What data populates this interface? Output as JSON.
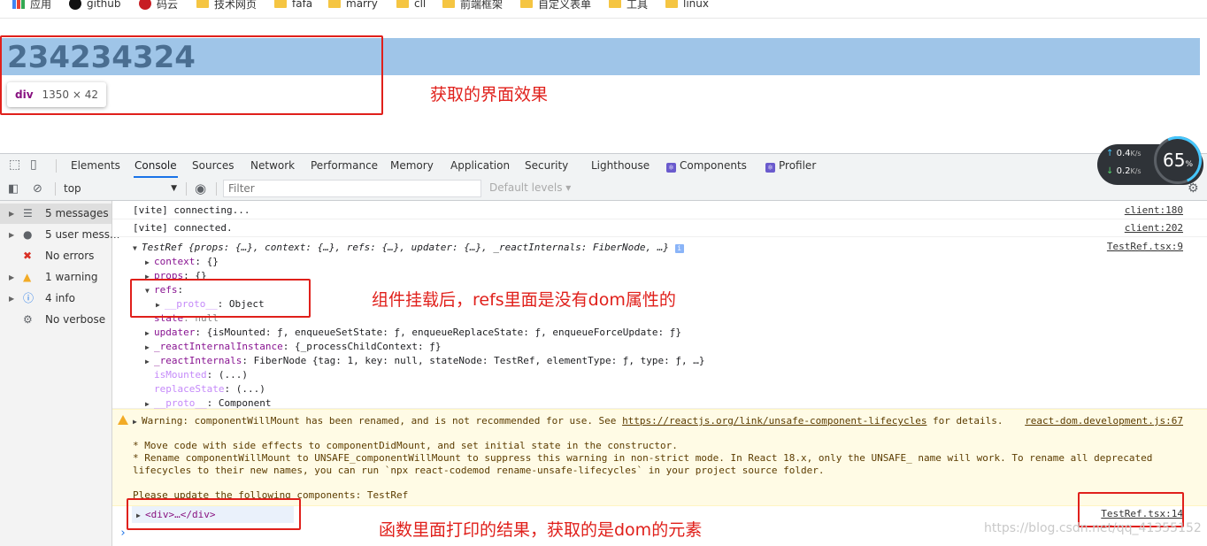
{
  "bookmarks": [
    {
      "label": "应用",
      "icon": "apps-grid-icon"
    },
    {
      "label": "github",
      "icon": "github-icon"
    },
    {
      "label": "码云",
      "icon": "gitee-icon"
    },
    {
      "label": "技术网页",
      "icon": "folder-icon"
    },
    {
      "label": "fafa",
      "icon": "folder-icon"
    },
    {
      "label": "marry",
      "icon": "folder-icon"
    },
    {
      "label": "cll",
      "icon": "folder-icon"
    },
    {
      "label": "前端框架",
      "icon": "folder-icon"
    },
    {
      "label": "自定义表单",
      "icon": "folder-icon"
    },
    {
      "label": "工具",
      "icon": "folder-icon"
    },
    {
      "label": "linux",
      "icon": "folder-icon"
    }
  ],
  "page": {
    "big_number": "234234324",
    "tooltip_tag": "div",
    "tooltip_dims": "1350 × 42"
  },
  "annotations": {
    "top_note": "获取的界面效果",
    "refs_note": "组件挂载后，refs里面是没有dom属性的",
    "bottom_note": "函数里面打印的结果，获取的是dom的元素"
  },
  "devtools": {
    "tabs": [
      "Elements",
      "Console",
      "Sources",
      "Network",
      "Performance",
      "Memory",
      "Application",
      "Security",
      "Lighthouse",
      "Components",
      "Profiler"
    ],
    "active_tab": "Console",
    "context": "top",
    "filter_placeholder": "Filter",
    "levels": "Default levels ▾",
    "sidebar": [
      {
        "label": "5 messages",
        "icon": "list-icon"
      },
      {
        "label": "5 user mess...",
        "icon": "user-icon"
      },
      {
        "label": "No errors",
        "icon": "error-icon"
      },
      {
        "label": "1 warning",
        "icon": "warning-icon"
      },
      {
        "label": "4 info",
        "icon": "info-icon"
      },
      {
        "label": "No verbose",
        "icon": "verbose-gear-icon"
      }
    ]
  },
  "console": {
    "vite1": {
      "text": "[vite] connecting...",
      "src": "client:180"
    },
    "vite2": {
      "text": "[vite] connected.",
      "src": "client:202"
    },
    "testref": {
      "head": "TestRef {props: {…}, context: {…}, refs: {…}, updater: {…}, _reactInternals: FiberNode, …}",
      "src": "TestRef.tsx:9",
      "context_key": "context",
      "context_val": ": {}",
      "props_key": "props",
      "props_val": ": {}",
      "refs_key": "refs",
      "proto_key": "__proto__",
      "proto_val": ": Object",
      "state_key": "state",
      "state_val": ": null",
      "updater_key": "updater",
      "updater_val": ": {isMounted: ƒ, enqueueSetState: ƒ, enqueueReplaceState: ƒ, enqueueForceUpdate: ƒ}",
      "ri_key": "_reactInternalInstance",
      "ri_val": ": {_processChildContext: ƒ}",
      "rin_key": "_reactInternals",
      "rin_val": ": FiberNode {tag: 1, key: null, stateNode: TestRef, elementType: ƒ, type: ƒ, …}",
      "ism_key": "isMounted",
      "ism_val": ": (...)",
      "rs_key": "replaceState",
      "rs_val": ": (...)",
      "proto2_key": "__proto__",
      "proto2_val": ": Component"
    },
    "warning": {
      "line1_pre": "Warning: componentWillMount has been renamed, and is not recommended for use. See ",
      "link": "https://reactjs.org/link/unsafe-component-lifecycles",
      "line1_post": " for details.",
      "src": "react-dom.development.js:67",
      "line2": "* Move code with side effects to componentDidMount, and set initial state in the constructor.",
      "line3": "* Rename componentWillMount to UNSAFE_componentWillMount to suppress this warning in non-strict mode. In React 18.x, only the UNSAFE_ name will work. To rename all deprecated",
      "line4": "lifecycles to their new names, you can run `npx react-codemod rename-unsafe-lifecycles` in your project source folder.",
      "line5": "Please update the following components: TestRef"
    },
    "div_row": {
      "text": "<div>…</div>",
      "src": "TestRef.tsx:14"
    },
    "prompt": "›"
  },
  "speed_widget": {
    "up": "0.4",
    "down": "0.2",
    "unit": "K/s",
    "percent": "65",
    "percent_sign": "%"
  },
  "watermark": "https://blog.csdn.net/qq_41355152"
}
